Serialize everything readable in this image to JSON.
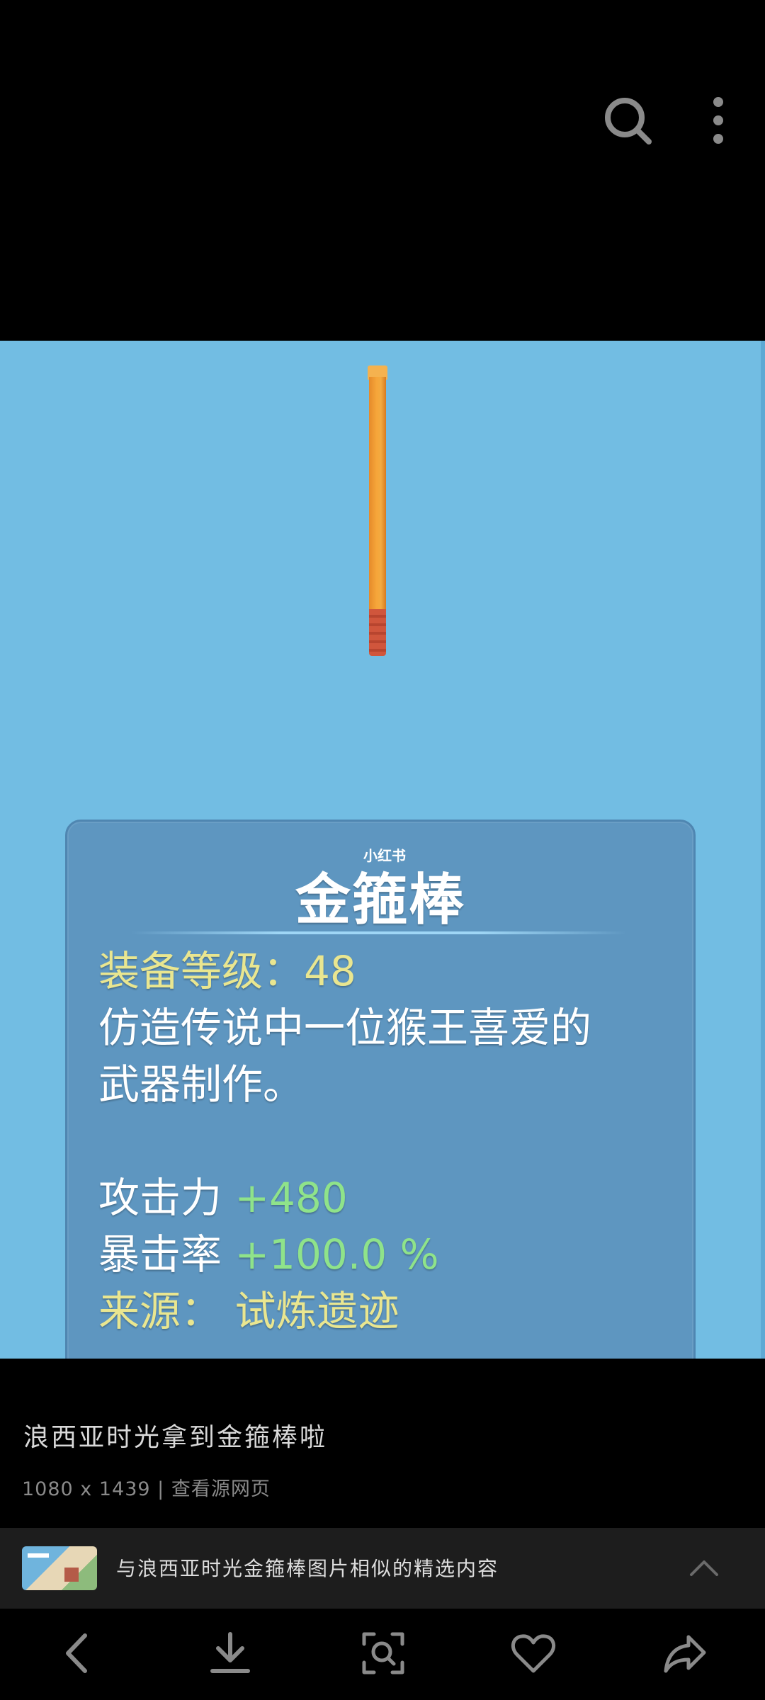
{
  "top_bar": {
    "search_icon": "search-icon",
    "more_icon": "more-vertical-icon"
  },
  "image": {
    "watermark": "小红书",
    "item_name": "金箍棒",
    "level_label": "装备等级：48",
    "description_line1": "仿造传说中一位猴王喜爱的",
    "description_line2": "武器制作。",
    "attack_label": "攻击力",
    "attack_value": "+480",
    "crit_label": "暴击率",
    "crit_value": "+100.0 %",
    "source_label": "来源：",
    "source_value": "试炼遗迹"
  },
  "caption": {
    "title": "浪西亚时光拿到金箍棒啦",
    "meta": "1080 x 1439 | 查看源网页"
  },
  "similar": {
    "text": "与浪西亚时光金箍棒图片相似的精选内容",
    "expand_icon": "chevron-up-icon"
  },
  "bottom_nav": {
    "items": [
      "back-icon",
      "download-icon",
      "scan-icon",
      "heart-icon",
      "share-icon"
    ]
  },
  "colors": {
    "image_background": "#72bde3",
    "card_background": "#5e96c0",
    "yellow_text": "#e9e690",
    "green_text": "#8fe38a"
  }
}
